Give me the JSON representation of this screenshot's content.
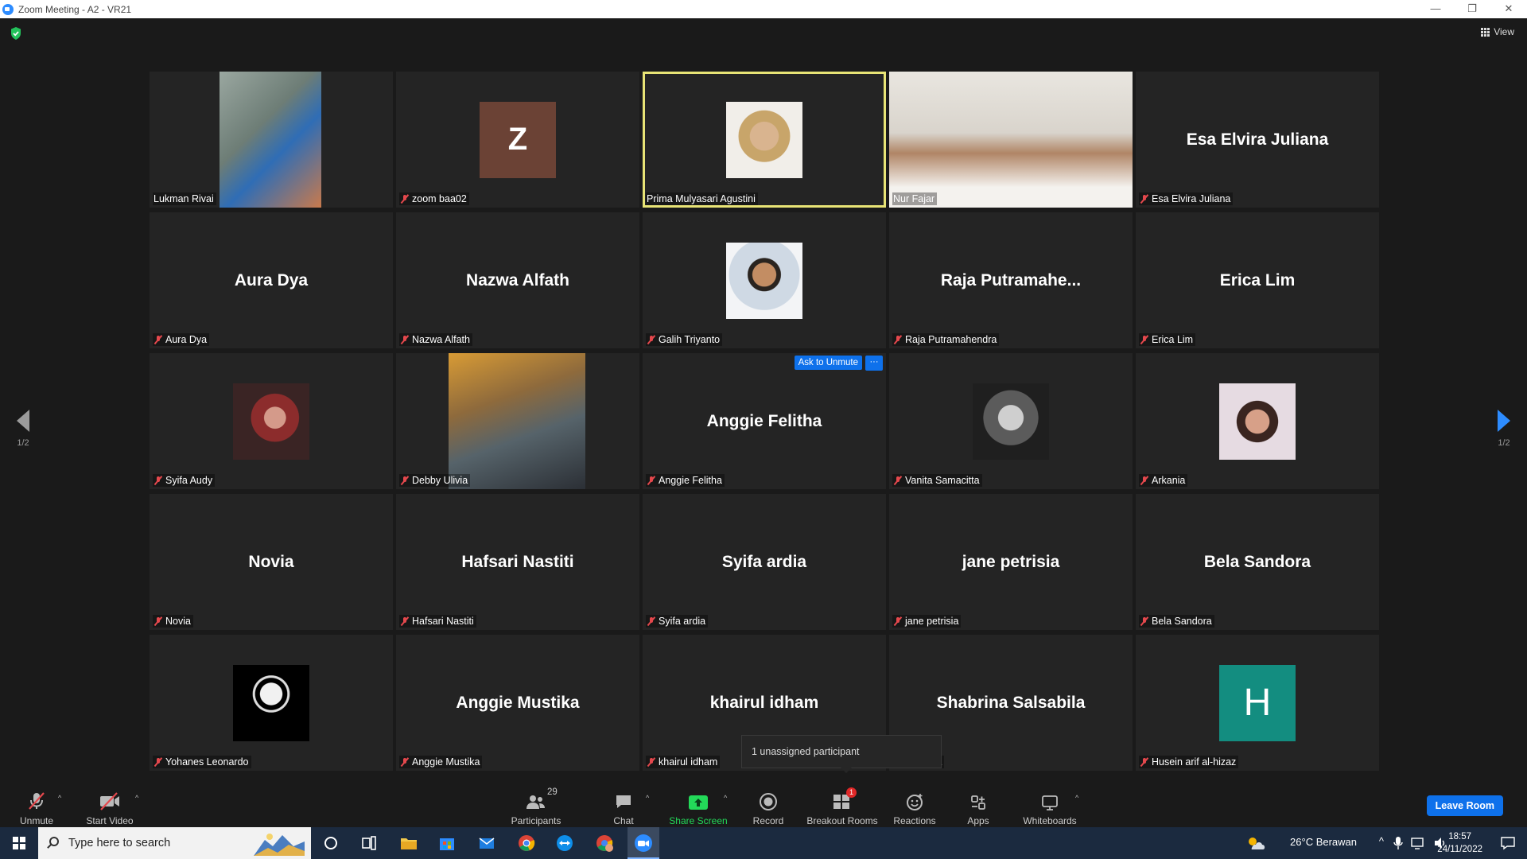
{
  "window": {
    "title": "Zoom Meeting - A2 - VR21",
    "minimize": "—",
    "restore": "❐",
    "close": "✕"
  },
  "meeting": {
    "view_label": "View",
    "page_left": "1/2",
    "page_right": "1/2",
    "ask_to_unmute": "Ask to Unmute",
    "more": "···",
    "tooltip": "1 unassigned participant",
    "participants": [
      {
        "name": "Lukman Rivai",
        "display": "",
        "type": "video",
        "muted": false
      },
      {
        "name": "zoom baa02",
        "display": "",
        "type": "letter",
        "letter": "Z",
        "muted": true
      },
      {
        "name": "Prima Mulyasari Agustini",
        "display": "",
        "type": "photo",
        "muted": false,
        "active": true
      },
      {
        "name": "Nur Fajar",
        "display": "",
        "type": "video",
        "muted": false
      },
      {
        "name": "Esa Elvira Juliana",
        "display": "Esa Elvira Juliana",
        "type": "name",
        "muted": true
      },
      {
        "name": "Aura Dya",
        "display": "Aura Dya",
        "type": "name",
        "muted": true
      },
      {
        "name": "Nazwa Alfath",
        "display": "Nazwa Alfath",
        "type": "name",
        "muted": true
      },
      {
        "name": "Galih Triyanto",
        "display": "",
        "type": "photo",
        "muted": true
      },
      {
        "name": "Raja Putramahendra",
        "display": "Raja  Putramahe...",
        "type": "name",
        "muted": true
      },
      {
        "name": "Erica Lim",
        "display": "Erica Lim",
        "type": "name",
        "muted": true
      },
      {
        "name": "Syifa Audy",
        "display": "",
        "type": "photo",
        "muted": true
      },
      {
        "name": "Debby Ulivia",
        "display": "",
        "type": "video",
        "muted": true
      },
      {
        "name": "Anggie Felitha",
        "display": "Anggie Felitha",
        "type": "name",
        "muted": true,
        "hover": true
      },
      {
        "name": "Vanita Samacitta",
        "display": "",
        "type": "photo",
        "muted": true
      },
      {
        "name": "Arkania",
        "display": "",
        "type": "photo",
        "muted": true
      },
      {
        "name": "Novia",
        "display": "Novia",
        "type": "name",
        "muted": true
      },
      {
        "name": "Hafsari Nastiti",
        "display": "Hafsari Nastiti",
        "type": "name",
        "muted": true
      },
      {
        "name": "Syifa ardia",
        "display": "Syifa ardia",
        "type": "name",
        "muted": true
      },
      {
        "name": "jane petrisia",
        "display": "jane petrisia",
        "type": "name",
        "muted": true
      },
      {
        "name": "Bela Sandora",
        "display": "Bela Sandora",
        "type": "name",
        "muted": true
      },
      {
        "name": "Yohanes Leonardo",
        "display": "",
        "type": "photo",
        "muted": true
      },
      {
        "name": "Anggie Mustika",
        "display": "Anggie Mustika",
        "type": "name",
        "muted": true
      },
      {
        "name": "khairul idham",
        "display": "khairul idham",
        "type": "name",
        "muted": true
      },
      {
        "name": "a Salsabila",
        "display": "Shabrina Salsabila",
        "type": "name",
        "muted": false
      },
      {
        "name": "Husein arif al-hizaz",
        "display": "",
        "type": "letter",
        "letter": "H",
        "muted": true
      }
    ]
  },
  "toolbar": {
    "unmute": "Unmute",
    "start_video": "Start Video",
    "participants": "Participants",
    "participants_count": "29",
    "chat": "Chat",
    "share_screen": "Share Screen",
    "record": "Record",
    "breakout_rooms": "Breakout Rooms",
    "breakout_badge": "1",
    "reactions": "Reactions",
    "apps": "Apps",
    "whiteboards": "Whiteboards",
    "leave": "Leave Room"
  },
  "taskbar": {
    "search_placeholder": "Type here to search",
    "weather": "26°C  Berawan",
    "time": "18:57",
    "date": "24/11/2022"
  },
  "colors": {
    "active_speaker": "#e8e476",
    "zoom_blue": "#0e71eb",
    "share_green": "#23d959",
    "muted_red": "#e5484d"
  }
}
